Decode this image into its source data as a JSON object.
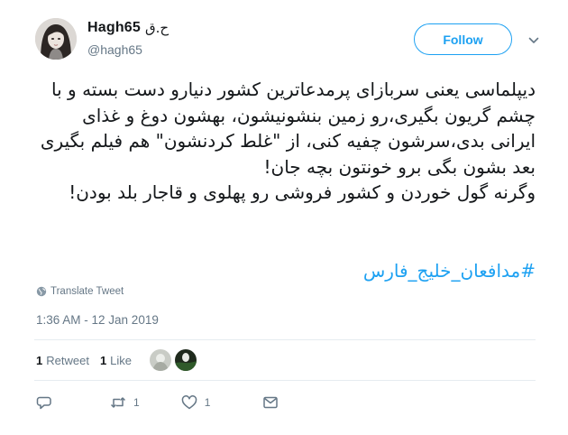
{
  "author": {
    "display_name": "Hagh65",
    "name_suffix": "ح.ق",
    "handle": "@hagh65"
  },
  "follow_button": {
    "label": "Follow"
  },
  "tweet": {
    "text": "دیپلماسی یعنی سربازای پرمدعاترین کشور دنیارو دست بسته و با چشم گریون بگیری،رو زمین بنشونیشون، بهشون دوغ و غذای ایرانی بدی،سرشون چفیه کنی، از \"غلط کردنشون\" هم فیلم بگیری بعد بشون بگی برو خونتون بچه جان!\nوگرنه گول خوردن و کشور فروشی رو پهلوی و قاجار بلد بودن!",
    "hashtag": "#مدافعان_خلیج_فارس",
    "translate_label": "Translate Tweet",
    "timestamp": "1:36 AM - 12 Jan 2019"
  },
  "stats": {
    "retweet_count": "1",
    "retweet_label": "Retweet",
    "like_count": "1",
    "like_label": "Like"
  },
  "actions": {
    "reply_count": "",
    "retweet_count": "1",
    "like_count": "1"
  },
  "colors": {
    "accent": "#1da1f2",
    "secondary_text": "#657786",
    "divider": "#e6ecf0"
  },
  "icons": [
    "caret-down-icon",
    "globe-icon",
    "reply-icon",
    "retweet-icon",
    "like-icon",
    "message-icon"
  ]
}
